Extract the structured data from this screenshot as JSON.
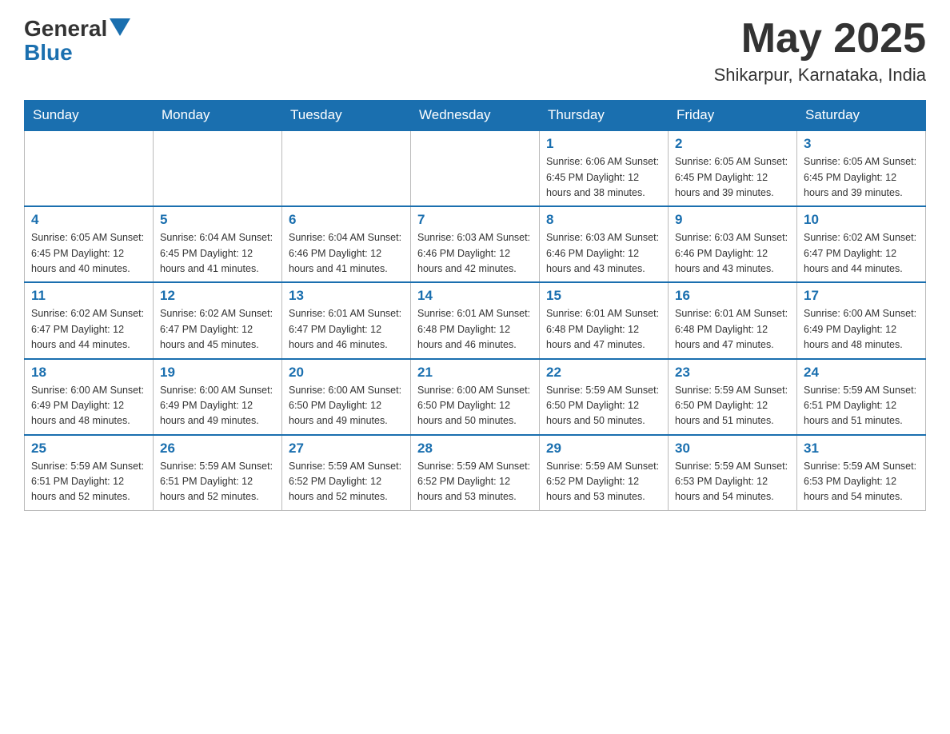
{
  "header": {
    "logo_general": "General",
    "logo_blue": "Blue",
    "month_year": "May 2025",
    "location": "Shikarpur, Karnataka, India"
  },
  "days_of_week": [
    "Sunday",
    "Monday",
    "Tuesday",
    "Wednesday",
    "Thursday",
    "Friday",
    "Saturday"
  ],
  "weeks": [
    {
      "days": [
        {
          "number": "",
          "info": ""
        },
        {
          "number": "",
          "info": ""
        },
        {
          "number": "",
          "info": ""
        },
        {
          "number": "",
          "info": ""
        },
        {
          "number": "1",
          "info": "Sunrise: 6:06 AM\nSunset: 6:45 PM\nDaylight: 12 hours\nand 38 minutes."
        },
        {
          "number": "2",
          "info": "Sunrise: 6:05 AM\nSunset: 6:45 PM\nDaylight: 12 hours\nand 39 minutes."
        },
        {
          "number": "3",
          "info": "Sunrise: 6:05 AM\nSunset: 6:45 PM\nDaylight: 12 hours\nand 39 minutes."
        }
      ]
    },
    {
      "days": [
        {
          "number": "4",
          "info": "Sunrise: 6:05 AM\nSunset: 6:45 PM\nDaylight: 12 hours\nand 40 minutes."
        },
        {
          "number": "5",
          "info": "Sunrise: 6:04 AM\nSunset: 6:45 PM\nDaylight: 12 hours\nand 41 minutes."
        },
        {
          "number": "6",
          "info": "Sunrise: 6:04 AM\nSunset: 6:46 PM\nDaylight: 12 hours\nand 41 minutes."
        },
        {
          "number": "7",
          "info": "Sunrise: 6:03 AM\nSunset: 6:46 PM\nDaylight: 12 hours\nand 42 minutes."
        },
        {
          "number": "8",
          "info": "Sunrise: 6:03 AM\nSunset: 6:46 PM\nDaylight: 12 hours\nand 43 minutes."
        },
        {
          "number": "9",
          "info": "Sunrise: 6:03 AM\nSunset: 6:46 PM\nDaylight: 12 hours\nand 43 minutes."
        },
        {
          "number": "10",
          "info": "Sunrise: 6:02 AM\nSunset: 6:47 PM\nDaylight: 12 hours\nand 44 minutes."
        }
      ]
    },
    {
      "days": [
        {
          "number": "11",
          "info": "Sunrise: 6:02 AM\nSunset: 6:47 PM\nDaylight: 12 hours\nand 44 minutes."
        },
        {
          "number": "12",
          "info": "Sunrise: 6:02 AM\nSunset: 6:47 PM\nDaylight: 12 hours\nand 45 minutes."
        },
        {
          "number": "13",
          "info": "Sunrise: 6:01 AM\nSunset: 6:47 PM\nDaylight: 12 hours\nand 46 minutes."
        },
        {
          "number": "14",
          "info": "Sunrise: 6:01 AM\nSunset: 6:48 PM\nDaylight: 12 hours\nand 46 minutes."
        },
        {
          "number": "15",
          "info": "Sunrise: 6:01 AM\nSunset: 6:48 PM\nDaylight: 12 hours\nand 47 minutes."
        },
        {
          "number": "16",
          "info": "Sunrise: 6:01 AM\nSunset: 6:48 PM\nDaylight: 12 hours\nand 47 minutes."
        },
        {
          "number": "17",
          "info": "Sunrise: 6:00 AM\nSunset: 6:49 PM\nDaylight: 12 hours\nand 48 minutes."
        }
      ]
    },
    {
      "days": [
        {
          "number": "18",
          "info": "Sunrise: 6:00 AM\nSunset: 6:49 PM\nDaylight: 12 hours\nand 48 minutes."
        },
        {
          "number": "19",
          "info": "Sunrise: 6:00 AM\nSunset: 6:49 PM\nDaylight: 12 hours\nand 49 minutes."
        },
        {
          "number": "20",
          "info": "Sunrise: 6:00 AM\nSunset: 6:50 PM\nDaylight: 12 hours\nand 49 minutes."
        },
        {
          "number": "21",
          "info": "Sunrise: 6:00 AM\nSunset: 6:50 PM\nDaylight: 12 hours\nand 50 minutes."
        },
        {
          "number": "22",
          "info": "Sunrise: 5:59 AM\nSunset: 6:50 PM\nDaylight: 12 hours\nand 50 minutes."
        },
        {
          "number": "23",
          "info": "Sunrise: 5:59 AM\nSunset: 6:50 PM\nDaylight: 12 hours\nand 51 minutes."
        },
        {
          "number": "24",
          "info": "Sunrise: 5:59 AM\nSunset: 6:51 PM\nDaylight: 12 hours\nand 51 minutes."
        }
      ]
    },
    {
      "days": [
        {
          "number": "25",
          "info": "Sunrise: 5:59 AM\nSunset: 6:51 PM\nDaylight: 12 hours\nand 52 minutes."
        },
        {
          "number": "26",
          "info": "Sunrise: 5:59 AM\nSunset: 6:51 PM\nDaylight: 12 hours\nand 52 minutes."
        },
        {
          "number": "27",
          "info": "Sunrise: 5:59 AM\nSunset: 6:52 PM\nDaylight: 12 hours\nand 52 minutes."
        },
        {
          "number": "28",
          "info": "Sunrise: 5:59 AM\nSunset: 6:52 PM\nDaylight: 12 hours\nand 53 minutes."
        },
        {
          "number": "29",
          "info": "Sunrise: 5:59 AM\nSunset: 6:52 PM\nDaylight: 12 hours\nand 53 minutes."
        },
        {
          "number": "30",
          "info": "Sunrise: 5:59 AM\nSunset: 6:53 PM\nDaylight: 12 hours\nand 54 minutes."
        },
        {
          "number": "31",
          "info": "Sunrise: 5:59 AM\nSunset: 6:53 PM\nDaylight: 12 hours\nand 54 minutes."
        }
      ]
    }
  ]
}
